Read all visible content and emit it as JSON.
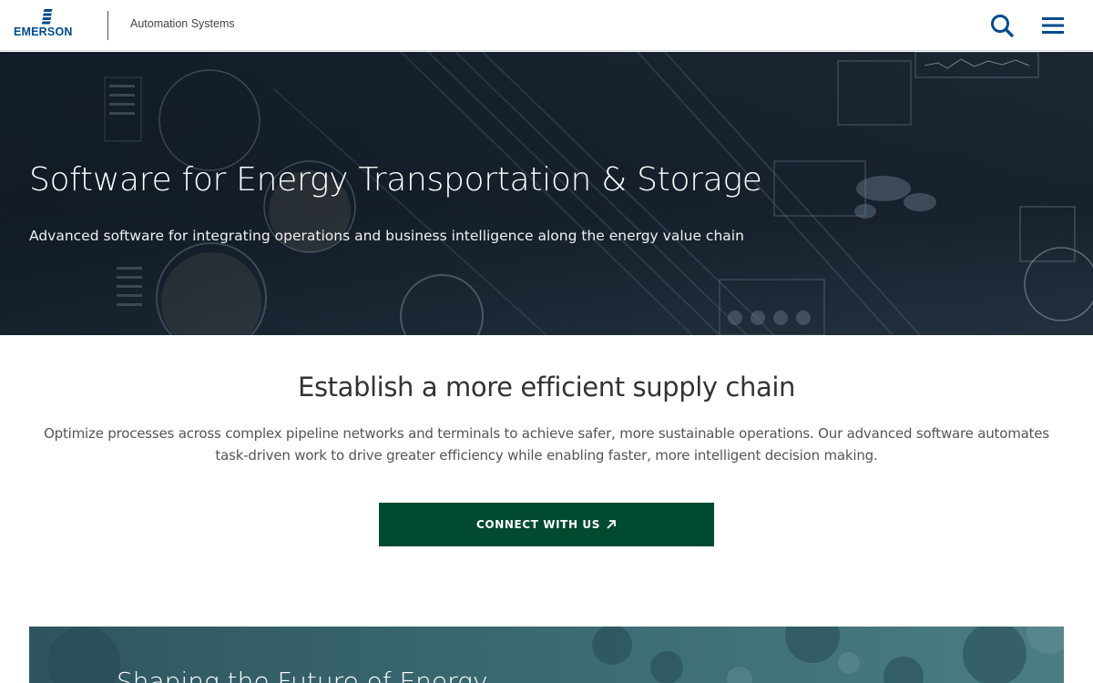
{
  "header": {
    "logo_text": "EMERSON",
    "site_name": "Automation Systems",
    "icons": {
      "search": "search-icon",
      "menu": "hamburger-menu-icon"
    },
    "brand_color": "#004b8d"
  },
  "hero": {
    "title": "Software for Energy Transportation & Storage",
    "subtitle": "Advanced software for integrating operations and business intelligence along the energy value chain"
  },
  "intro": {
    "heading": "Establish a more efficient supply chain",
    "body": "Optimize processes across complex pipeline networks and terminals to achieve safer, more sustainable operations. Our advanced software automates task-driven work to drive greater efficiency while enabling faster, more intelligent decision making.",
    "cta_label": "CONNECT WITH US",
    "cta_icon": "external-arrow-icon",
    "cta_color": "#004b2f"
  },
  "promo": {
    "title": "Shaping the Future of Energy"
  }
}
